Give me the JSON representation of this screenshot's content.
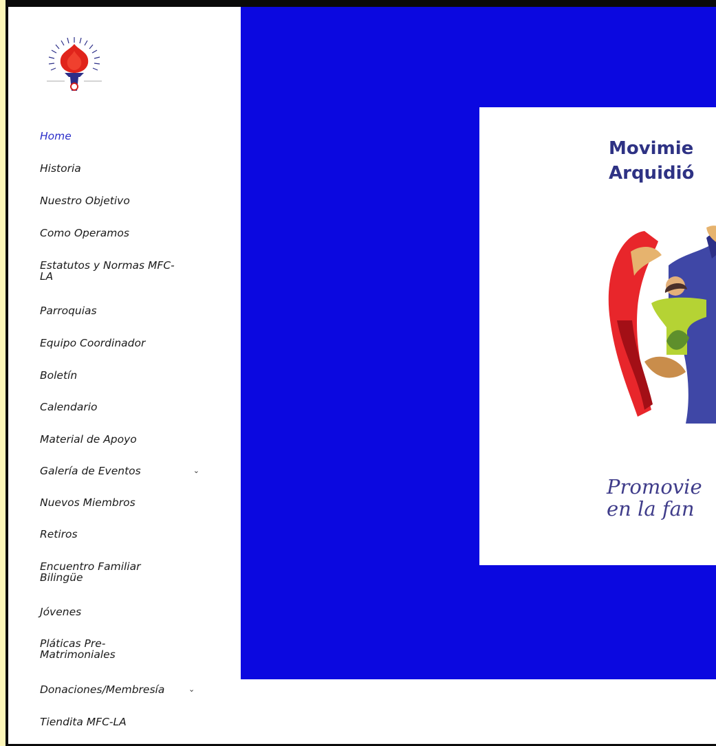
{
  "sidebar": {
    "logo_icon": "torch-flame-logo",
    "nav_items": [
      {
        "label": "Home",
        "active": true
      },
      {
        "label": "Historia"
      },
      {
        "label": "Nuestro Objetivo"
      },
      {
        "label": "Como Operamos"
      },
      {
        "label": "Estatutos y Normas MFC-",
        "label2": "LA"
      },
      {
        "label": "Parroquias"
      },
      {
        "label": "Equipo Coordinador"
      },
      {
        "label": "Boletín"
      },
      {
        "label": "Calendario"
      },
      {
        "label": "Material de Apoyo"
      },
      {
        "label": "Galería de Eventos",
        "dropdown_icon": "chevron-down-icon"
      },
      {
        "label": "Nuevos Miembros"
      },
      {
        "label": "Retiros"
      },
      {
        "label": "Encuentro Familiar",
        "label2": "Bilingüe"
      },
      {
        "label": "Jóvenes"
      },
      {
        "label": "Pláticas Pre-",
        "label2": "Matrimoniales"
      },
      {
        "label": "Donaciones/Membresía",
        "dropdown_icon": "chevron-down-icon"
      },
      {
        "label": "Tiendita MFC-LA"
      }
    ]
  },
  "hero": {
    "background_color": "#0b08e0",
    "card": {
      "title_line1": "Movimie",
      "title_line2": "Arquidió",
      "tagline_line1": "Promovie",
      "tagline_line2": "en la fan",
      "illustration_icon": "family-embrace-illustration"
    }
  },
  "colors": {
    "page_background": "#fdf6b8",
    "frame": "#0a0a0a",
    "active_nav": "#2b2ec9",
    "card_title": "#2e3284"
  }
}
